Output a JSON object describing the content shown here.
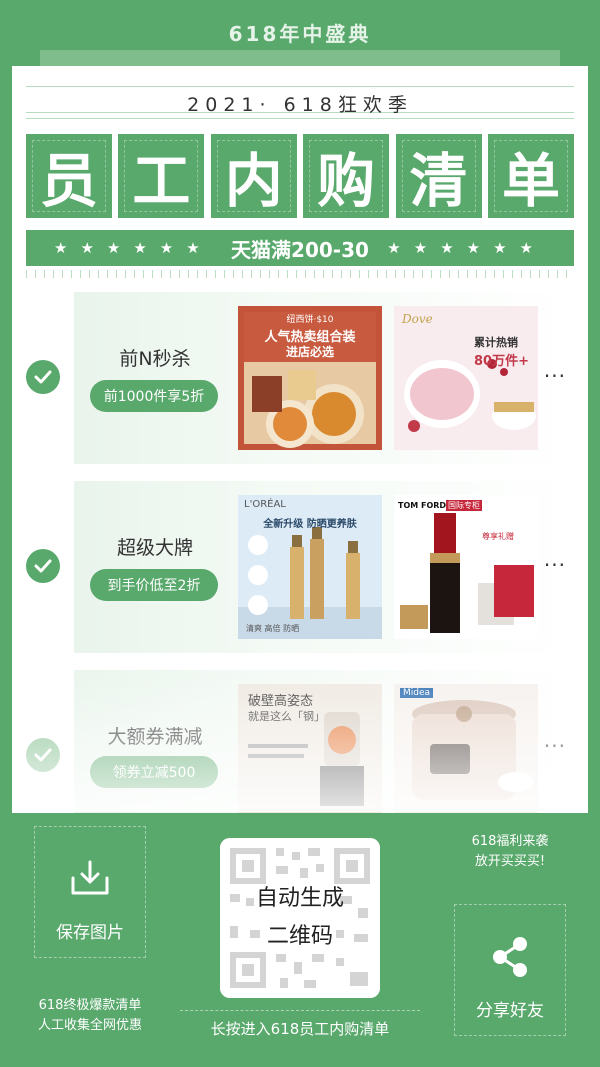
{
  "header": {
    "title": "618年中盛典"
  },
  "hero": {
    "edition": "2021· 618狂欢季",
    "title_chars": [
      "员",
      "工",
      "内",
      "购",
      "清",
      "单"
    ],
    "stars": "★★★★★★",
    "promo": "天猫满200-30"
  },
  "sections": [
    {
      "title": "前N秒杀",
      "tag": "前1000件享5折",
      "more": "···",
      "products": [
        {
          "brand": "纽西饼·$10",
          "headline": "人气热卖组合装",
          "sub": "进店必选"
        },
        {
          "brand": "Dove",
          "headline": "累计热销",
          "sub": "80万件+"
        }
      ]
    },
    {
      "title": "超级大牌",
      "tag": "到手价低至2折",
      "more": "···",
      "products": [
        {
          "brand": "L'ORÉAL",
          "headline": "全新升级 防晒更养肤",
          "sub": "清爽 高倍 防晒"
        },
        {
          "brand": "TOM FORD",
          "headline": "国际专柜",
          "sub": "尊享礼赠"
        }
      ]
    },
    {
      "title": "大额券满减",
      "tag": "领券立减500",
      "more": "···",
      "products": [
        {
          "brand": "",
          "headline": "破壁高姿态",
          "sub": "就是这么「钢」"
        },
        {
          "brand": "Midea",
          "headline": "",
          "sub": ""
        }
      ]
    }
  ],
  "footer": {
    "save_label": "保存图片",
    "note_lines": [
      "618终极爆款清单",
      "人工收集全网优惠"
    ],
    "qr_lines": [
      "自动生成",
      "二维码"
    ],
    "qr_caption": "长按进入618员工内购清单",
    "promo_lines": [
      "618福利来袭",
      "放开买买买!"
    ],
    "share_label": "分享好友"
  },
  "colors": {
    "brand_green": "#59a86c",
    "light_green": "#e9f4ec",
    "text_dark": "#333333"
  }
}
